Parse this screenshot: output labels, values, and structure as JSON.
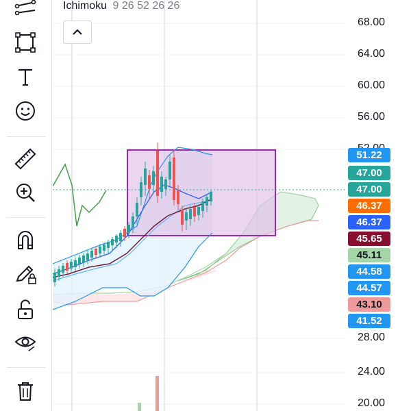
{
  "toolbar": {
    "tools": [
      {
        "name": "trend-lines-icon"
      },
      {
        "name": "rectangle-icon"
      },
      {
        "name": "text-icon"
      },
      {
        "name": "emoji-icon"
      },
      {
        "name": "ruler-icon"
      },
      {
        "name": "zoom-in-icon"
      },
      {
        "name": "magnet-icon"
      },
      {
        "name": "lock-drawing-icon"
      },
      {
        "name": "unlock-icon"
      },
      {
        "name": "eye-icon"
      },
      {
        "name": "trash-icon"
      }
    ]
  },
  "indicator": {
    "name": "Ichimoku",
    "params": "9 26 52 26 26"
  },
  "price_axis": {
    "ticks": [
      "68.00",
      "64.00",
      "60.00",
      "56.00",
      "52.00",
      "28.00",
      "24.00",
      "20.00"
    ]
  },
  "price_badges": [
    {
      "label": "51.22",
      "bg": "#2196f3",
      "fg": "#ffffff"
    },
    {
      "label": "47.00",
      "bg": "#26a69a",
      "fg": "#ffffff"
    },
    {
      "label": "47.00",
      "bg": "#26a69a",
      "fg": "#ffffff"
    },
    {
      "label": "46.37",
      "bg": "#ff6d00",
      "fg": "#ffffff"
    },
    {
      "label": "46.37",
      "bg": "#2962ff",
      "fg": "#ffffff"
    },
    {
      "label": "45.65",
      "bg": "#880e2f",
      "fg": "#ffffff"
    },
    {
      "label": "45.11",
      "bg": "#a5d6a7",
      "fg": "#131722"
    },
    {
      "label": "44.58",
      "bg": "#2196f3",
      "fg": "#ffffff"
    },
    {
      "label": "44.57",
      "bg": "#2196f3",
      "fg": "#ffffff"
    },
    {
      "label": "43.10",
      "bg": "#ef9a9a",
      "fg": "#131722"
    },
    {
      "label": "41.52",
      "bg": "#2196f3",
      "fg": "#ffffff"
    }
  ],
  "colors": {
    "up": "#26a69a",
    "down": "#ef5350",
    "rectangle_border": "#9c27b0",
    "rectangle_fill": "#e1bee7"
  }
}
